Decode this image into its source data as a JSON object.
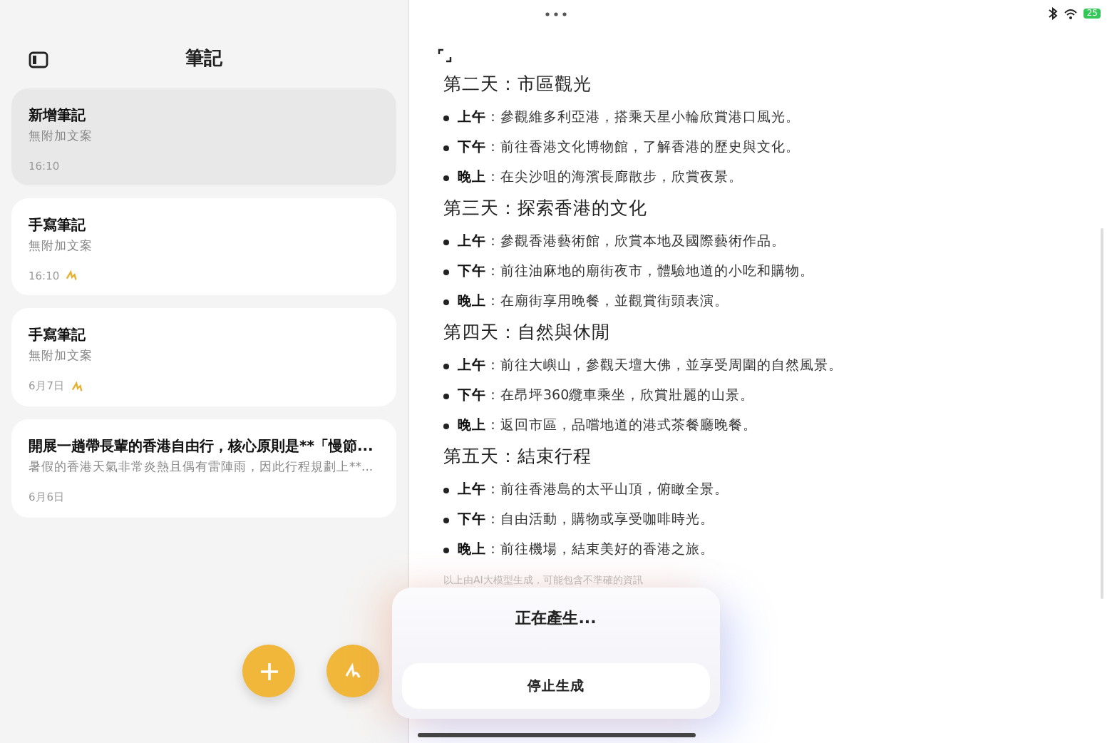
{
  "status_bar": {
    "battery": "25"
  },
  "sidebar": {
    "title": "筆記",
    "notes": [
      {
        "title": "新增筆記",
        "subtitle": "無附加文案",
        "time": "16:10",
        "handwritten": false,
        "selected": true
      },
      {
        "title": "手寫筆記",
        "subtitle": "無附加文案",
        "time": "16:10",
        "handwritten": true,
        "selected": false
      },
      {
        "title": "手寫筆記",
        "subtitle": "無附加文案",
        "time": "6月7日",
        "handwritten": true,
        "selected": false
      },
      {
        "title": "開展一趟帶長輩的香港自由行，核心原則是**「慢節...",
        "subtitle": "暑假的香港天氣非常炎熱且偶有雷陣雨，因此行程規劃上**...",
        "time": "6月6日",
        "handwritten": false,
        "selected": false
      }
    ]
  },
  "editor": {
    "sections": [
      {
        "heading": "第二天：市區觀光",
        "items": [
          {
            "label": "上午",
            "text": "：參觀維多利亞港，搭乘天星小輪欣賞港口風光。"
          },
          {
            "label": "下午",
            "text": "：前往香港文化博物館，了解香港的歷史與文化。"
          },
          {
            "label": "晚上",
            "text": "：在尖沙咀的海濱長廊散步，欣賞夜景。"
          }
        ]
      },
      {
        "heading": "第三天：探索香港的文化",
        "items": [
          {
            "label": "上午",
            "text": "：參觀香港藝術館，欣賞本地及國際藝術作品。"
          },
          {
            "label": "下午",
            "text": "：前往油麻地的廟街夜市，體驗地道的小吃和購物。"
          },
          {
            "label": "晚上",
            "text": "：在廟街享用晚餐，並觀賞街頭表演。"
          }
        ]
      },
      {
        "heading": "第四天：自然與休閒",
        "items": [
          {
            "label": "上午",
            "text": "：前往大嶼山，參觀天壇大佛，並享受周圍的自然風景。"
          },
          {
            "label": "下午",
            "text": "：在昂坪360纜車乘坐，欣賞壯麗的山景。"
          },
          {
            "label": "晚上",
            "text": "：返回市區，品嚐地道的港式茶餐廳晚餐。"
          }
        ]
      },
      {
        "heading": "第五天：結束行程",
        "items": [
          {
            "label": "上午",
            "text": "：前往香港島的太平山頂，俯瞰全景。"
          },
          {
            "label": "下午",
            "text": "：自由活動，購物或享受咖啡時光。"
          },
          {
            "label": "晚上",
            "text": "：前往機場，結束美好的香港之旅。"
          }
        ]
      }
    ],
    "disclaimer": "以上由AI大模型生成，可能包含不準確的資訊"
  },
  "generating_panel": {
    "status": "正在產生...",
    "button": "停止生成"
  }
}
